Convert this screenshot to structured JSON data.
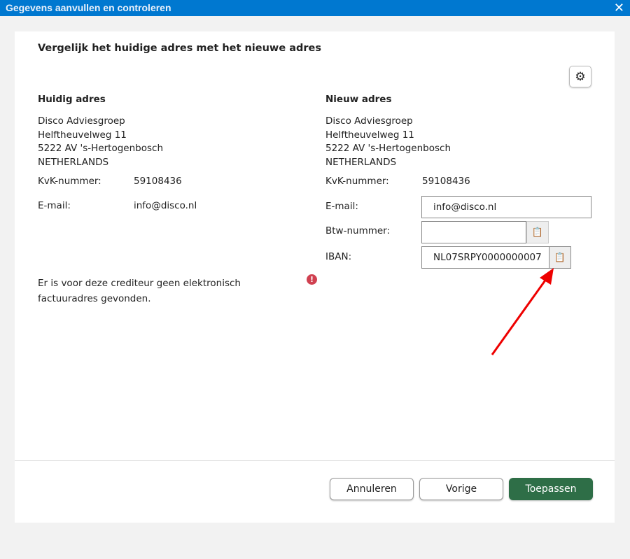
{
  "window": {
    "title": "Gegevens aanvullen en controleren",
    "close": "✕"
  },
  "heading": "Vergelijk het huidige adres met het nieuwe adres",
  "current": {
    "title": "Huidig adres",
    "lines": [
      "Disco Adviesgroep",
      "Helftheuvelweg 11",
      "5222 AV 's-Hertogenbosch",
      "NETHERLANDS"
    ],
    "kvk_label": "KvK-nummer:",
    "kvk": "59108436",
    "email_label": "E-mail:",
    "email": "info@disco.nl"
  },
  "new": {
    "title": "Nieuw adres",
    "lines": [
      "Disco Adviesgroep",
      "Helftheuvelweg 11",
      "5222 AV 's-Hertogenbosch",
      "NETHERLANDS"
    ],
    "kvk_label": "KvK-nummer:",
    "kvk": "59108436",
    "email_label": "E-mail:",
    "email": "info@disco.nl",
    "btw_label": "Btw-nummer:",
    "btw": "",
    "iban_label": "IBAN:",
    "iban": "NL07SRPY0000000007"
  },
  "warning": "Er is voor deze crediteur geen elektronisch factuuradres gevonden.",
  "buttons": {
    "cancel": "Annuleren",
    "previous": "Vorige",
    "apply": "Toepassen"
  }
}
